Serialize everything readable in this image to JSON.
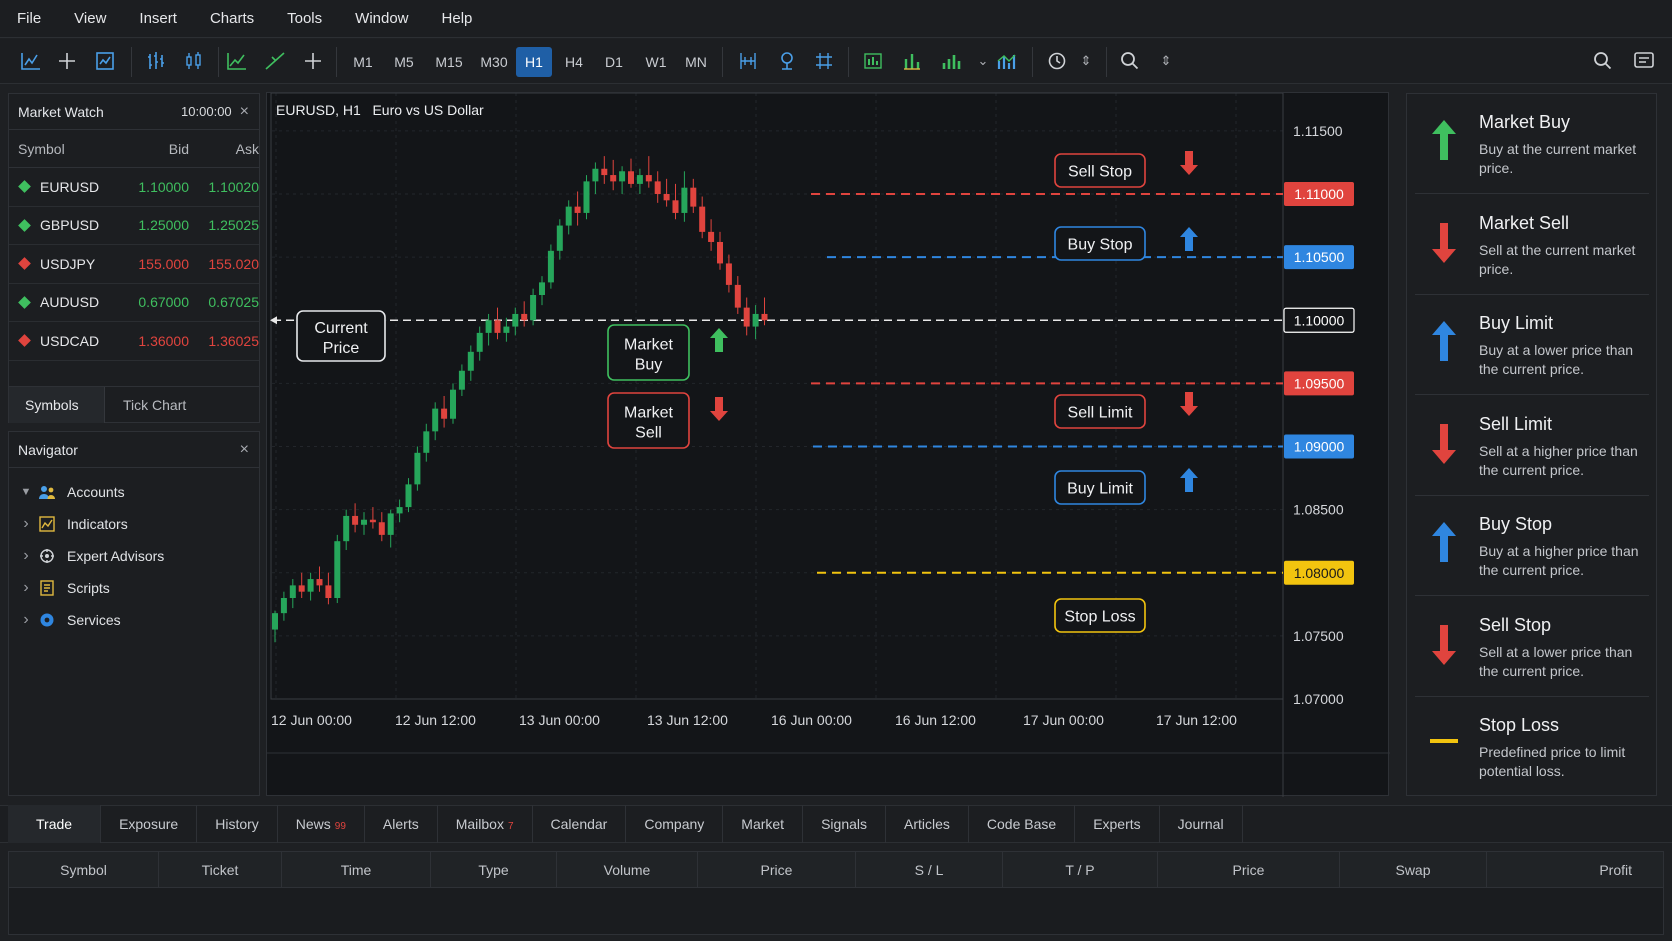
{
  "menu": [
    "File",
    "View",
    "Insert",
    "Charts",
    "Tools",
    "Window",
    "Help"
  ],
  "toolbar": {
    "timeframes": [
      "M1",
      "M5",
      "M15",
      "M30",
      "H1",
      "H4",
      "D1",
      "W1",
      "MN"
    ],
    "active_timeframe": "H1",
    "icons": [
      "new-chart-icon",
      "crosshair-icon",
      "strategy-tester-icon",
      "bar-chart-icon",
      "candlestick-icon",
      "line-chart-icon",
      "trendline-icon",
      "add-object-icon",
      "period-separator-icon",
      "pin-icon",
      "grid-icon",
      "indicator-green-icon",
      "indicator-bars-icon",
      "volume-icon",
      "oscillator-icon",
      "market-clock-icon",
      "search-icon",
      "global-search-icon",
      "chat-icon"
    ]
  },
  "market_watch": {
    "title": "Market Watch",
    "time": "10:00:00",
    "columns": {
      "symbol": "Symbol",
      "bid": "Bid",
      "ask": "Ask"
    },
    "rows": [
      {
        "symbol": "EURUSD",
        "bid": "1.10000",
        "ask": "1.10020",
        "color": "#3fbf5f"
      },
      {
        "symbol": "GBPUSD",
        "bid": "1.25000",
        "ask": "1.25025",
        "color": "#3fbf5f"
      },
      {
        "symbol": "USDJPY",
        "bid": "155.000",
        "ask": "155.020",
        "color": "#e0443e"
      },
      {
        "symbol": "AUDUSD",
        "bid": "0.67000",
        "ask": "0.67025",
        "color": "#3fbf5f"
      },
      {
        "symbol": "USDCAD",
        "bid": "1.36000",
        "ask": "1.36025",
        "color": "#e0443e"
      }
    ],
    "tabs": [
      "Symbols",
      "Tick Chart"
    ]
  },
  "navigator": {
    "title": "Navigator",
    "items": [
      {
        "label": "Accounts",
        "icon": "accounts-icon",
        "expanded": true
      },
      {
        "label": "Indicators",
        "icon": "indicators-icon"
      },
      {
        "label": "Expert Advisors",
        "icon": "expert-advisors-icon"
      },
      {
        "label": "Scripts",
        "icon": "scripts-icon"
      },
      {
        "label": "Services",
        "icon": "services-icon"
      }
    ]
  },
  "chart": {
    "title": "EURUSD, H1   Euro vs US Dollar",
    "annotations": {
      "current_price": "Current Price",
      "market_buy": "Market Buy",
      "market_sell": "Market Sell",
      "sell_stop": "Sell Stop",
      "buy_stop": "Buy Stop",
      "sell_limit": "Sell Limit",
      "buy_limit": "Buy Limit",
      "stop_loss": "Stop Loss"
    }
  },
  "chart_data": {
    "type": "candlestick",
    "title": "EURUSD, H1   Euro vs US Dollar",
    "y_ticks": [
      "1.11500",
      "1.10500",
      "1.10000",
      "1.09000",
      "1.08500",
      "1.07500",
      "1.07000"
    ],
    "ylim": [
      1.07,
      1.118
    ],
    "x_ticks": [
      "12 Jun 00:00",
      "12 Jun 12:00",
      "13 Jun 00:00",
      "13 Jun 12:00",
      "16 Jun 00:00",
      "16 Jun 12:00",
      "17 Jun 00:00",
      "17 Jun 12:00"
    ],
    "current_price": "1.10000",
    "levels": [
      {
        "name": "Sell Stop",
        "price": 1.11,
        "label": "1.11000",
        "color": "#e0443e"
      },
      {
        "name": "Buy Stop",
        "price": 1.105,
        "label": "1.10500",
        "color": "#2f86e0"
      },
      {
        "name": "Current Price",
        "price": 1.1,
        "label": "1.10000",
        "color": "#e8e8e8"
      },
      {
        "name": "Sell Limit",
        "price": 1.095,
        "label": "1.09500",
        "color": "#e0443e"
      },
      {
        "name": "Buy Limit",
        "price": 1.09,
        "label": "1.09000",
        "color": "#2f86e0"
      },
      {
        "name": "Stop Loss",
        "price": 1.08,
        "label": "1.08000",
        "color": "#f2c40f"
      }
    ],
    "candles": [
      [
        1.0755,
        1.077,
        1.0745,
        1.0768
      ],
      [
        1.0768,
        1.0785,
        1.0762,
        1.078
      ],
      [
        1.078,
        1.0795,
        1.0772,
        1.079
      ],
      [
        1.079,
        1.08,
        1.078,
        1.0785
      ],
      [
        1.0785,
        1.08,
        1.0778,
        1.0795
      ],
      [
        1.0795,
        1.0805,
        1.0785,
        1.079
      ],
      [
        1.079,
        1.08,
        1.0775,
        1.078
      ],
      [
        1.078,
        1.083,
        1.0776,
        1.0825
      ],
      [
        1.0825,
        1.085,
        1.0818,
        1.0845
      ],
      [
        1.0845,
        1.0855,
        1.0832,
        1.0838
      ],
      [
        1.0838,
        1.0848,
        1.083,
        1.0842
      ],
      [
        1.0842,
        1.0852,
        1.0835,
        1.084
      ],
      [
        1.084,
        1.0848,
        1.0825,
        1.083
      ],
      [
        1.083,
        1.085,
        1.082,
        1.0847
      ],
      [
        1.0847,
        1.0858,
        1.084,
        1.0852
      ],
      [
        1.0852,
        1.0875,
        1.0848,
        1.087
      ],
      [
        1.087,
        1.09,
        1.0865,
        1.0895
      ],
      [
        1.0895,
        1.0918,
        1.0888,
        1.0912
      ],
      [
        1.0912,
        1.0935,
        1.0905,
        1.093
      ],
      [
        1.093,
        1.094,
        1.0915,
        1.0922
      ],
      [
        1.0922,
        1.095,
        1.0918,
        1.0945
      ],
      [
        1.0945,
        1.0965,
        1.094,
        1.096
      ],
      [
        1.096,
        1.098,
        1.0952,
        1.0975
      ],
      [
        1.0975,
        1.0995,
        1.0968,
        1.099
      ],
      [
        1.099,
        1.1005,
        1.098,
        1.1
      ],
      [
        1.1,
        1.101,
        1.0985,
        1.099
      ],
      [
        1.099,
        1.1002,
        1.0983,
        1.0995
      ],
      [
        1.0995,
        1.101,
        1.0988,
        1.1005
      ],
      [
        1.1005,
        1.1015,
        1.0995,
        1.1
      ],
      [
        1.1,
        1.1025,
        1.0996,
        1.102
      ],
      [
        1.102,
        1.1035,
        1.1012,
        1.103
      ],
      [
        1.103,
        1.106,
        1.1025,
        1.1055
      ],
      [
        1.1055,
        1.108,
        1.1048,
        1.1075
      ],
      [
        1.1075,
        1.1095,
        1.1068,
        1.109
      ],
      [
        1.109,
        1.1102,
        1.1075,
        1.1085
      ],
      [
        1.1085,
        1.1115,
        1.108,
        1.111
      ],
      [
        1.111,
        1.1125,
        1.11,
        1.112
      ],
      [
        1.112,
        1.113,
        1.1108,
        1.1115
      ],
      [
        1.1115,
        1.1127,
        1.1103,
        1.111
      ],
      [
        1.111,
        1.1122,
        1.11,
        1.1118
      ],
      [
        1.1118,
        1.1128,
        1.1105,
        1.1108
      ],
      [
        1.1108,
        1.112,
        1.11,
        1.1115
      ],
      [
        1.1115,
        1.113,
        1.1105,
        1.111
      ],
      [
        1.111,
        1.1118,
        1.1093,
        1.11
      ],
      [
        1.11,
        1.1112,
        1.109,
        1.1095
      ],
      [
        1.1095,
        1.1108,
        1.108,
        1.1085
      ],
      [
        1.1085,
        1.1118,
        1.1078,
        1.1105
      ],
      [
        1.1105,
        1.1112,
        1.1085,
        1.109
      ],
      [
        1.109,
        1.1098,
        1.1065,
        1.107
      ],
      [
        1.107,
        1.108,
        1.1055,
        1.1062
      ],
      [
        1.1062,
        1.107,
        1.104,
        1.1045
      ],
      [
        1.1045,
        1.1052,
        1.1022,
        1.1028
      ],
      [
        1.1028,
        1.1035,
        1.1005,
        1.101
      ],
      [
        1.101,
        1.1018,
        1.0988,
        1.0995
      ],
      [
        1.0995,
        1.1012,
        1.0985,
        1.1005
      ],
      [
        1.1005,
        1.1018,
        1.0996,
        1.1
      ]
    ]
  },
  "legend": [
    {
      "title": "Market Buy",
      "desc": "Buy at the current market price.",
      "icon": "up-arrow-icon",
      "color": "#3fbf5f",
      "kind": "up"
    },
    {
      "title": "Market Sell",
      "desc": "Sell at the current market price.",
      "icon": "down-arrow-icon",
      "color": "#e0443e",
      "kind": "down"
    },
    {
      "title": "Buy Limit",
      "desc": "Buy at a lower price than the current price.",
      "icon": "up-arrow-icon",
      "color": "#2f86e0",
      "kind": "up"
    },
    {
      "title": "Sell Limit",
      "desc": "Sell at a higher price than the current price.",
      "icon": "down-arrow-icon",
      "color": "#e0443e",
      "kind": "down"
    },
    {
      "title": "Buy Stop",
      "desc": "Buy at a higher price than the current price.",
      "icon": "up-arrow-icon",
      "color": "#2f86e0",
      "kind": "up"
    },
    {
      "title": "Sell Stop",
      "desc": "Sell at a lower price than the current price.",
      "icon": "down-arrow-icon",
      "color": "#e0443e",
      "kind": "down"
    },
    {
      "title": "Stop Loss",
      "desc": "Predefined price to limit potential loss.",
      "icon": "stop-loss-line-icon",
      "color": "#f2c40f",
      "kind": "line"
    }
  ],
  "bottom_tabs": [
    {
      "label": "Trade",
      "selected": true
    },
    {
      "label": "Exposure"
    },
    {
      "label": "History"
    },
    {
      "label": "News",
      "badge": "99"
    },
    {
      "label": "Alerts"
    },
    {
      "label": "Mailbox",
      "badge": "7"
    },
    {
      "label": "Calendar"
    },
    {
      "label": "Company"
    },
    {
      "label": "Market"
    },
    {
      "label": "Signals"
    },
    {
      "label": "Articles"
    },
    {
      "label": "Code Base"
    },
    {
      "label": "Experts"
    },
    {
      "label": "Journal"
    }
  ],
  "trade_table": {
    "columns": [
      "Symbol",
      "Ticket",
      "Time",
      "Type",
      "Volume",
      "Price",
      "S / L",
      "T / P",
      "Price",
      "Swap",
      "Profit"
    ]
  }
}
